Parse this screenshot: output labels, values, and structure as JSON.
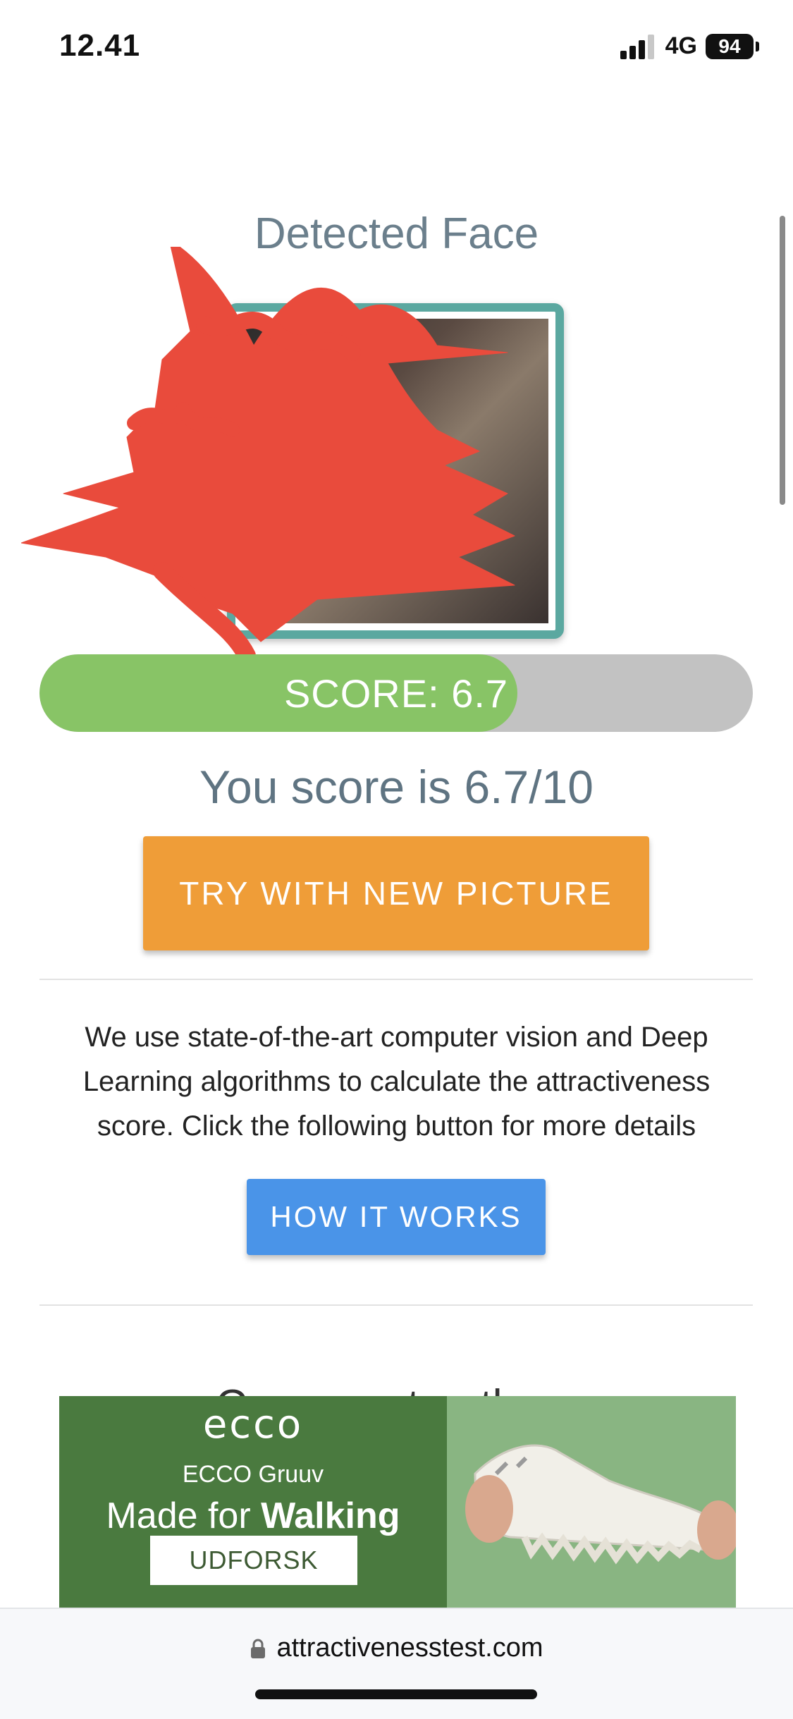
{
  "status_bar": {
    "time": "12.41",
    "network": "4G",
    "battery": "94",
    "signal_icon": "cellular-signal-icon",
    "battery_icon": "battery-icon"
  },
  "result": {
    "title": "Detected Face",
    "score_label": "SCORE: 6.7",
    "score_value": 6.7,
    "score_max": 10,
    "score_sentence": "You score is 6.7/10",
    "try_button_label": "TRY WITH NEW PICTURE"
  },
  "info": {
    "description": "We use state-of-the-art computer vision and Deep Learning algorithms to calculate the attractiveness score. Click the following button for more details",
    "how_button_label": "HOW IT WORKS",
    "next_heading_partial": "Compare to others"
  },
  "ad": {
    "brand": "ecco",
    "product": "ECCO Gruuv",
    "tagline_prefix": "Made for ",
    "tagline_bold": "Walking",
    "cta": "UDFORSK"
  },
  "browser": {
    "url": "attractivenesstest.com",
    "lock_icon": "lock-icon"
  },
  "colors": {
    "score_fill": "#88c466",
    "score_track": "#c2c2c2",
    "try_button": "#ef9d38",
    "how_button": "#4a94e8",
    "face_border": "#5ba8a0",
    "redaction": "#e94b3c",
    "ad_green": "#4a7a3f"
  }
}
